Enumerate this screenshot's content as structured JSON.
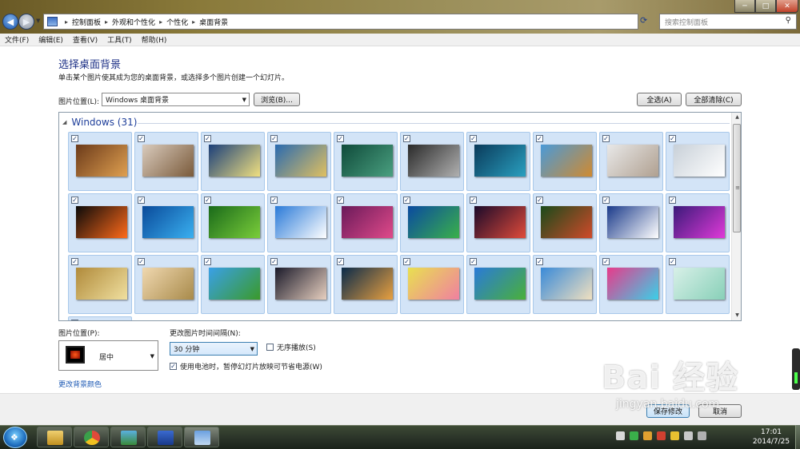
{
  "window": {
    "min": "─",
    "max": "□",
    "close": "✕"
  },
  "nav": {
    "back": "◀",
    "forward": "▶",
    "drop": "▼"
  },
  "address": {
    "crumbs": [
      "控制面板",
      "外观和个性化",
      "个性化",
      "桌面背景"
    ],
    "sep": "▸",
    "refresh": "⟳"
  },
  "search": {
    "placeholder": "搜索控制面板",
    "icon": "magnifier-icon"
  },
  "menu": [
    "文件(F)",
    "编辑(E)",
    "查看(V)",
    "工具(T)",
    "帮助(H)"
  ],
  "page": {
    "title": "选择桌面背景",
    "desc": "单击某个图片使其成为您的桌面背景，或选择多个图片创建一个幻灯片。"
  },
  "location": {
    "label": "图片位置(L):",
    "value": "Windows 桌面背景",
    "browse": "浏览(B)...",
    "select_all": "全选(A)",
    "clear_all": "全部清除(C)"
  },
  "gallery": {
    "group": "Windows (31)",
    "checked": "✓",
    "images": [
      [
        "#6b3a1a",
        "#e0a050"
      ],
      [
        "#d9cbbd",
        "#7a5a3a"
      ],
      [
        "#1b3f7a",
        "#f0e080"
      ],
      [
        "#2a6ab0",
        "#e0c060"
      ],
      [
        "#0f4a3a",
        "#4aa080"
      ],
      [
        "#2a2a2a",
        "#b0b0b0"
      ],
      [
        "#0a3a5a",
        "#2aa0c0"
      ],
      [
        "#4a9ad8",
        "#d08a30"
      ],
      [
        "#e8e8e8",
        "#b0a090"
      ],
      [
        "#c8d0d8",
        "#ffffff"
      ],
      [
        "#0a0a0a",
        "#ff6a1a"
      ],
      [
        "#0a4a9a",
        "#3ab0f0"
      ],
      [
        "#1a6a1a",
        "#7acd3a"
      ],
      [
        "#2a7ad8",
        "#ffffff"
      ],
      [
        "#6a1a5a",
        "#e04a8a"
      ],
      [
        "#0a4aa0",
        "#3ab04a"
      ],
      [
        "#1a0a2a",
        "#e04a3a"
      ],
      [
        "#1a4a1a",
        "#d04a2a"
      ],
      [
        "#1a3a8a",
        "#ffffff"
      ],
      [
        "#3a1a7a",
        "#e03ad8"
      ],
      [
        "#b08a3a",
        "#f0e0a0"
      ],
      [
        "#f0d8b0",
        "#a88a4a"
      ],
      [
        "#3aa0e8",
        "#3a9a2a"
      ],
      [
        "#1a1a2a",
        "#e8d0c0"
      ],
      [
        "#0a2a4a",
        "#e8a040"
      ],
      [
        "#e8e050",
        "#f080a0"
      ],
      [
        "#2a7ad8",
        "#4ab03a"
      ],
      [
        "#3a8ad8",
        "#f0e0c0"
      ],
      [
        "#e83a8a",
        "#3ad0e8"
      ],
      [
        "#d8f0e8",
        "#88d0b8"
      ]
    ]
  },
  "position": {
    "label": "图片位置(P):",
    "value": "居中"
  },
  "interval": {
    "label": "更改图片时间间隔(N):",
    "value": "30 分钟",
    "shuffle": "无序播放(S)",
    "battery": "使用电池时，暂停幻灯片放映可节省电源(W)"
  },
  "bg_color": "更改背景颜色",
  "buttons": {
    "save": "保存修改",
    "cancel": "取消"
  },
  "watermark": {
    "main": "Bai 经验",
    "sub": "jingyan.baidu.com"
  },
  "clock": {
    "time": "17:01",
    "date": "2014/7/25"
  }
}
